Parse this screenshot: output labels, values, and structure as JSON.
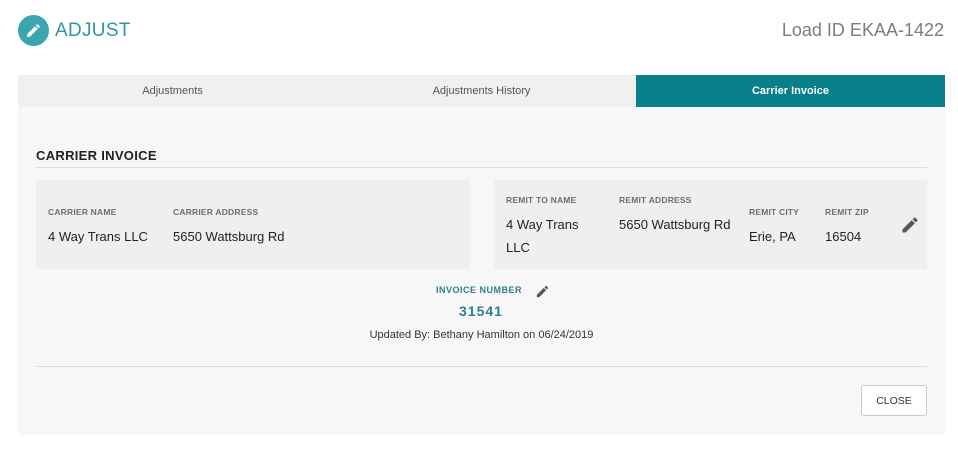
{
  "header": {
    "title": "ADJUST",
    "load_id": "Load ID EKAA-1422",
    "accent": "#3aa6b0"
  },
  "tabs": [
    {
      "label": "Adjustments",
      "active": false
    },
    {
      "label": "Adjustments History",
      "active": false
    },
    {
      "label": "Carrier Invoice",
      "active": true
    }
  ],
  "section": {
    "title": "CARRIER INVOICE"
  },
  "carrier": {
    "name_label": "CARRIER NAME",
    "name": "4 Way Trans LLC",
    "address_label": "CARRIER ADDRESS",
    "address": "5650 Wattsburg Rd"
  },
  "remit": {
    "name_label": "REMIT TO NAME",
    "name": "4 Way Trans LLC",
    "address_label": "REMIT ADDRESS",
    "address": "5650 Wattsburg Rd",
    "city_label": "REMIT CITY",
    "city": "Erie, PA",
    "zip_label": "REMIT ZIP",
    "zip": "16504",
    "edit_icon": "pencil-icon"
  },
  "invoice": {
    "label": "INVOICE NUMBER",
    "number": "31541",
    "updated": "Updated By: Bethany Hamilton on 06/24/2019",
    "edit_icon": "pencil-icon"
  },
  "footer": {
    "close_label": "CLOSE"
  },
  "colors": {
    "active_tab": "#087f8a",
    "invoice_text": "#2f7f88"
  }
}
